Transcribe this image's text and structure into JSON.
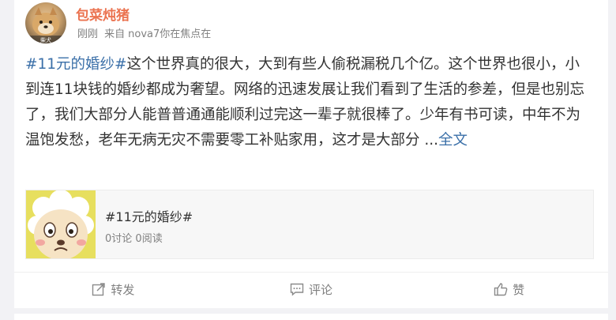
{
  "post": {
    "username": "包菜炖猪",
    "time": "刚刚",
    "source_prefix": "来自",
    "source": "nova7你在焦点在",
    "topic_tag": "#11元的婚纱#",
    "text_body": "这个世界真的很大，大到有些人偷税漏税几个亿。这个世界也很小，小到连11块钱的婚纱都成为奢望。网络的迅速发展让我们看到了生活的参差，但是也别忘了，我们大部分人能普普通通能顺利过完这一辈子就很棒了。少年有书可读，中年不为温饱发愁，老年无病无灾不需要零工补贴家用，这才是大部分 ...",
    "more_link": "全文",
    "avatar_watermark": "柴犬",
    "colors": {
      "username": "#eb7350",
      "link": "#3a6fa8",
      "text": "#333333",
      "muted": "#808080"
    }
  },
  "topic_card": {
    "title": "#11元的婚纱#",
    "discussions": "0讨论",
    "reads": "0阅读"
  },
  "actions": {
    "repost": {
      "label": "转发",
      "icon": "repost-icon"
    },
    "comment": {
      "label": "评论",
      "icon": "comment-icon"
    },
    "like": {
      "label": "赞",
      "icon": "thumbs-up-icon"
    }
  }
}
